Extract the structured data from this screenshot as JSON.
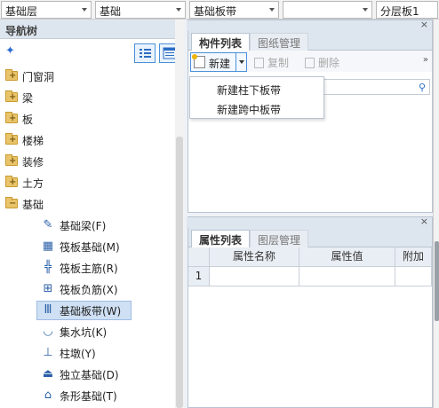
{
  "topbar": {
    "dropdowns": [
      "基础层",
      "基础",
      "基础板带",
      "",
      "分层板1"
    ]
  },
  "nav": {
    "title": "导航树",
    "tree": [
      {
        "label": "门窗洞"
      },
      {
        "label": "梁"
      },
      {
        "label": "板"
      },
      {
        "label": "楼梯"
      },
      {
        "label": "装修"
      },
      {
        "label": "土方"
      },
      {
        "label": "基础"
      }
    ],
    "children": [
      {
        "label": "基础梁(F)",
        "icon": "pencil-icon"
      },
      {
        "label": "筏板基础(M)",
        "icon": "raft-icon"
      },
      {
        "label": "筏板主筋(R)",
        "icon": "rebar-icon"
      },
      {
        "label": "筏板负筋(X)",
        "icon": "negative-rebar-icon"
      },
      {
        "label": "基础板带(W)",
        "icon": "strip-icon",
        "selected": true
      },
      {
        "label": "集水坑(K)",
        "icon": "sump-icon"
      },
      {
        "label": "柱墩(Y)",
        "icon": "pier-icon"
      },
      {
        "label": "独立基础(D)",
        "icon": "isolated-footing-icon"
      },
      {
        "label": "条形基础(T)",
        "icon": "strip-footing-icon"
      }
    ]
  },
  "upper": {
    "tabs": [
      "构件列表",
      "图纸管理"
    ],
    "toolbar": {
      "new": "新建",
      "copy": "复制",
      "delete": "删除"
    },
    "menu": [
      "新建柱下板带",
      "新建跨中板带"
    ]
  },
  "lower": {
    "tabs": [
      "属性列表",
      "图层管理"
    ],
    "columns": [
      "属性名称",
      "属性值",
      "附加"
    ],
    "rows": [
      {
        "num": "1",
        "name": "",
        "value": "",
        "extra": ""
      }
    ]
  }
}
